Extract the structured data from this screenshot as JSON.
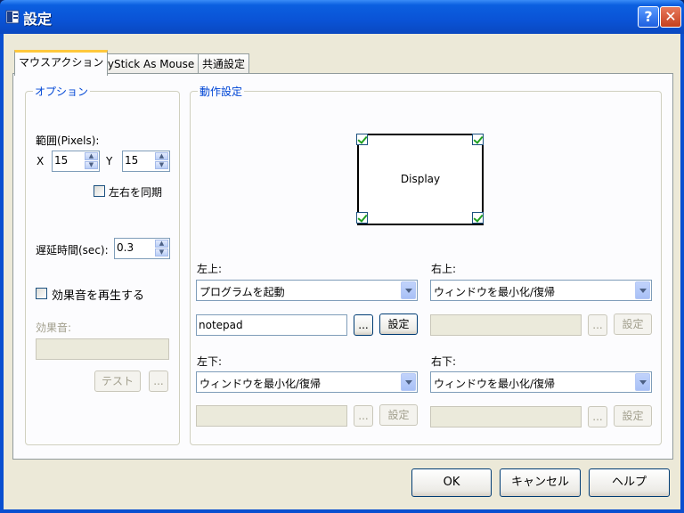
{
  "window": {
    "title": "設定",
    "help_label": "?",
    "close_label": "✕"
  },
  "tabs": [
    {
      "label": "マウスアクション"
    },
    {
      "label": "JoyStick As Mouse"
    },
    {
      "label": "共通設定"
    }
  ],
  "options": {
    "group_label": "オプション",
    "range_label": "範囲(Pixels):",
    "x_label": "X",
    "x_value": "15",
    "y_label": "Y",
    "y_value": "15",
    "sync_label": "左右を同期",
    "delay_label": "遅延時間(sec):",
    "delay_value": "0.3",
    "sound_enable_label": "効果音を再生する",
    "sound_label": "効果音:",
    "sound_value": "",
    "test_label": "テスト",
    "browse_label": "..."
  },
  "action": {
    "group_label": "動作設定",
    "display_label": "Display",
    "top_left": {
      "label": "左上:",
      "action": "プログラムを起動",
      "arg": "notepad",
      "browse": "...",
      "settings": "設定"
    },
    "top_right": {
      "label": "右上:",
      "action": "ウィンドウを最小化/復帰",
      "arg": "",
      "browse": "...",
      "settings": "設定"
    },
    "bottom_left": {
      "label": "左下:",
      "action": "ウィンドウを最小化/復帰",
      "arg": "",
      "browse": "...",
      "settings": "設定"
    },
    "bottom_right": {
      "label": "右下:",
      "action": "ウィンドウを最小化/復帰",
      "arg": "",
      "browse": "...",
      "settings": "設定"
    }
  },
  "footer": {
    "ok": "OK",
    "cancel": "キャンセル",
    "help": "ヘルプ"
  }
}
